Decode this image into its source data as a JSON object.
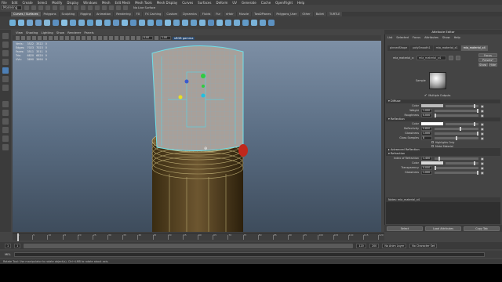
{
  "menubar": [
    "File",
    "Edit",
    "Create",
    "Select",
    "Modify",
    "Display",
    "Windows",
    "Mesh",
    "Edit Mesh",
    "Mesh Tools",
    "Mesh Display",
    "Curves",
    "Surfaces",
    "Deform",
    "UV",
    "Generate",
    "Cache",
    "OpenFlight",
    "Help"
  ],
  "status": {
    "mode": "Modeling",
    "no_live": "No Live Surface",
    "camera_field": "0"
  },
  "shelf_tabs": [
    {
      "label": "Curves / Surfaces",
      "active": true
    },
    {
      "label": "Polygons",
      "active": false
    },
    {
      "label": "Sculpting",
      "active": false
    },
    {
      "label": "Rigging",
      "active": false
    },
    {
      "label": "Animation",
      "active": false
    },
    {
      "label": "Rendering",
      "active": false
    },
    {
      "label": "FX",
      "active": false
    },
    {
      "label": "FX Caching",
      "active": false
    },
    {
      "label": "Custom",
      "active": false
    },
    {
      "label": "Dynamics",
      "active": false
    },
    {
      "label": "Fluids",
      "active": false
    },
    {
      "label": "Fur",
      "active": false
    },
    {
      "label": "nHair",
      "active": false
    },
    {
      "label": "Muscle",
      "active": false
    },
    {
      "label": "TwoDPlanes",
      "active": false
    },
    {
      "label": "Polygons_User",
      "active": false
    },
    {
      "label": "Other",
      "active": false
    },
    {
      "label": "Bullet",
      "active": false
    },
    {
      "label": "TURTLE",
      "active": false
    }
  ],
  "panel_menu": [
    "View",
    "Shading",
    "Lighting",
    "Show",
    "Renderer",
    "Panels"
  ],
  "viewport_toolbar": {
    "value_a": "0.00",
    "value_b": "1.00",
    "gamma": "sRGB gamma"
  },
  "hud": {
    "rows": [
      {
        "label": "Verts:",
        "a": "3522",
        "b": "3522",
        "c": "0"
      },
      {
        "label": "Edges:",
        "a": "7023",
        "b": "7023",
        "c": "0"
      },
      {
        "label": "Faces:",
        "a": "3511",
        "b": "3511",
        "c": "0"
      },
      {
        "label": "Tris:",
        "a": "6820",
        "b": "6820",
        "c": "0"
      },
      {
        "label": "UVs:",
        "a": "3690",
        "b": "3690",
        "c": "0"
      }
    ]
  },
  "timeline": {
    "ticks": [
      "1",
      "5",
      "10",
      "15",
      "20",
      "25",
      "30",
      "35",
      "40",
      "45",
      "50",
      "55",
      "60",
      "65",
      "70",
      "75",
      "80",
      "85",
      "90",
      "95",
      "100",
      "105",
      "110",
      "115",
      "120"
    ],
    "current": "1"
  },
  "range": {
    "start": "1",
    "inner_start": "1",
    "inner_end": "120",
    "end": "200",
    "anim_layer": "No Anim Layer",
    "char_set": "No Character Set"
  },
  "mel": {
    "label": "MEL"
  },
  "helpline": "Rotate Tool: Use manipulator to rotate object(s). Ctrl+LMB to rotate about axis.",
  "attribute_editor": {
    "title": "Attribute Editor",
    "menu": [
      "List",
      "Selected",
      "Focus",
      "Attributes",
      "Show",
      "Help"
    ],
    "tabs": [
      {
        "label": "pinnedShape",
        "active": false
      },
      {
        "label": "polySmooth1",
        "active": false
      },
      {
        "label": "mia_material_x1",
        "active": false
      },
      {
        "label": "mia_material_x4",
        "active": true
      }
    ],
    "node_type": "mia_material_x:",
    "node_name": "mia_material_x4",
    "focus_btn": "Focus",
    "presets_btn": "Presets*",
    "show_btn": "Show",
    "hide_btn": "Hide",
    "sample_label": "Sample",
    "multiple_outputs": "Multiple Outputs",
    "sections": {
      "diffuse": "Diffuse",
      "reflection": "Reflection",
      "advanced_reflection": "Advanced Reflection",
      "refraction": "Refraction"
    },
    "diffuse_rows": [
      {
        "label": "Color",
        "value": "",
        "swatch": "#bbbbbb"
      },
      {
        "label": "Weight",
        "value": "1.000"
      },
      {
        "label": "Roughness",
        "value": "0.000"
      }
    ],
    "reflection_rows": [
      {
        "label": "Color",
        "value": "",
        "swatch": "#ffffff"
      },
      {
        "label": "Reflectivity",
        "value": "0.600"
      },
      {
        "label": "Glossiness",
        "value": "1.000"
      },
      {
        "label": "Gloss Samples",
        "value": "8"
      }
    ],
    "highlights_only": "Highlights Only",
    "metal_material": "Metal Material",
    "refraction_rows": [
      {
        "label": "Index of Refraction",
        "value": "1.400"
      },
      {
        "label": "Color",
        "value": "",
        "swatch": "#d8d8d8"
      },
      {
        "label": "Transparency",
        "value": "0.000"
      },
      {
        "label": "Glossiness",
        "value": "1.000"
      }
    ],
    "notes": "Notes:  mia_material_x4",
    "select_btn": "Select",
    "load_btn": "Load Attributes",
    "copy_btn": "Copy Tab"
  }
}
